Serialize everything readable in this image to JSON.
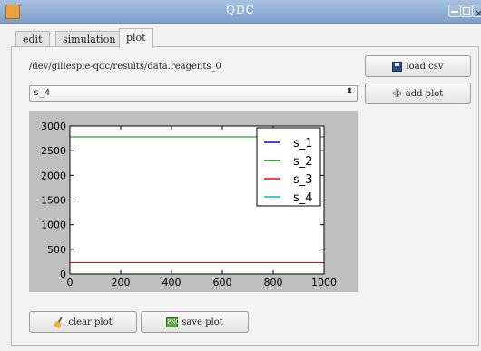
{
  "window": {
    "title": "QDC"
  },
  "tabs": [
    {
      "label": "edit"
    },
    {
      "label": "simulation"
    },
    {
      "label": "plot",
      "active": true
    }
  ],
  "plot_tab": {
    "file_path": "/dev/gillespie-qdc/results/data.reagents_0",
    "load_csv_label": "load csv",
    "species_select": "s_4",
    "add_plot_label": "add plot",
    "clear_plot_label": "clear plot",
    "save_plot_label": "save plot",
    "save_icon_text": "PNG"
  },
  "chart_data": {
    "type": "line",
    "xlim": [
      0,
      1000
    ],
    "ylim": [
      0,
      3000
    ],
    "x_ticks": [
      0,
      200,
      400,
      600,
      800,
      1000
    ],
    "y_ticks": [
      0,
      500,
      1000,
      1500,
      2000,
      2500,
      3000
    ],
    "grid": false,
    "legend": "top-right",
    "series": [
      {
        "name": "s_1",
        "color": "#0000ff",
        "x": [
          0,
          1000
        ],
        "y": [
          0,
          0
        ]
      },
      {
        "name": "s_2",
        "color": "#008000",
        "x": [
          0,
          1000
        ],
        "y": [
          2780,
          2780
        ]
      },
      {
        "name": "s_3",
        "color": "#ff0000",
        "x": [
          0,
          1000
        ],
        "y": [
          230,
          230
        ]
      },
      {
        "name": "s_4",
        "color": "#00bfbf",
        "x": [
          0,
          1000
        ],
        "y": [
          0,
          0
        ]
      }
    ]
  }
}
